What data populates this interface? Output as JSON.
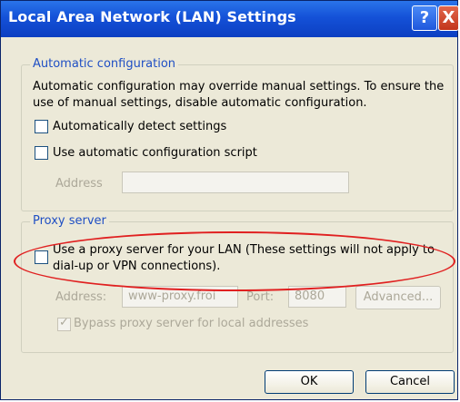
{
  "window": {
    "title": "Local Area Network (LAN) Settings",
    "help_label": "?",
    "close_label": "X"
  },
  "auto": {
    "group_label": "Automatic configuration",
    "description_line1": "Automatic configuration may override manual settings.  To ensure the",
    "description_line2": "use of manual settings, disable automatic configuration.",
    "detect_label": "Automatically detect settings",
    "script_label": "Use automatic configuration script",
    "address_label": "Address",
    "address_value": ""
  },
  "proxy": {
    "group_label": "Proxy server",
    "use_label_line1": "Use a proxy server for your LAN (These settings will not apply to",
    "use_label_line2": "dial-up or VPN connections).",
    "address_label": "Address:",
    "address_value": "www-proxy.froi",
    "port_label": "Port:",
    "port_value": "8080",
    "advanced_label": "Advanced...",
    "bypass_label": "Bypass proxy server for local addresses"
  },
  "buttons": {
    "ok": "OK",
    "cancel": "Cancel"
  },
  "colors": {
    "titlebar": "#1451d8",
    "highlight_oval": "#e02020",
    "group_label": "#1f4fc4"
  }
}
